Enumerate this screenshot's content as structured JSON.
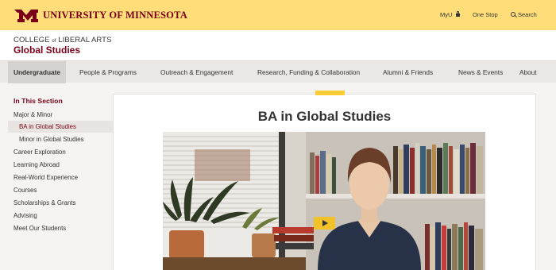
{
  "top_bar": {
    "university_name": "University of Minnesota",
    "links": {
      "myu": "MyU",
      "one_stop": "One Stop",
      "search": "Search"
    },
    "brand_color": "#7a0019",
    "bar_color": "#ffde7a"
  },
  "college": {
    "name_before": "COLLEGE",
    "name_of": "of",
    "name_after": "LIBERAL ARTS",
    "unit": "Global Studies"
  },
  "nav": {
    "items": [
      {
        "label": "Undergraduate",
        "active": true
      },
      {
        "label": "People & Programs"
      },
      {
        "label": "Outreach & Engagement"
      },
      {
        "label": "Research, Funding & Collaboration"
      },
      {
        "label": "Alumni & Friends"
      },
      {
        "label": "News & Events"
      },
      {
        "label": "About"
      }
    ]
  },
  "sidebar": {
    "title": "In This Section",
    "items": [
      {
        "label": "Major & Minor"
      },
      {
        "label": "BA in Global Studies",
        "current": true
      },
      {
        "label": "Minor in Global Studies"
      },
      {
        "label": "Career Exploration"
      },
      {
        "label": "Learning Abroad"
      },
      {
        "label": "Real-World Experience"
      },
      {
        "label": "Courses"
      },
      {
        "label": "Scholarships & Grants"
      },
      {
        "label": "Advising"
      },
      {
        "label": "Meet Our Students"
      }
    ]
  },
  "main": {
    "heading": "BA in Global Studies",
    "accent_color": "#ffcc33"
  },
  "icons": [
    "lock-icon",
    "search-icon",
    "play-icon"
  ]
}
